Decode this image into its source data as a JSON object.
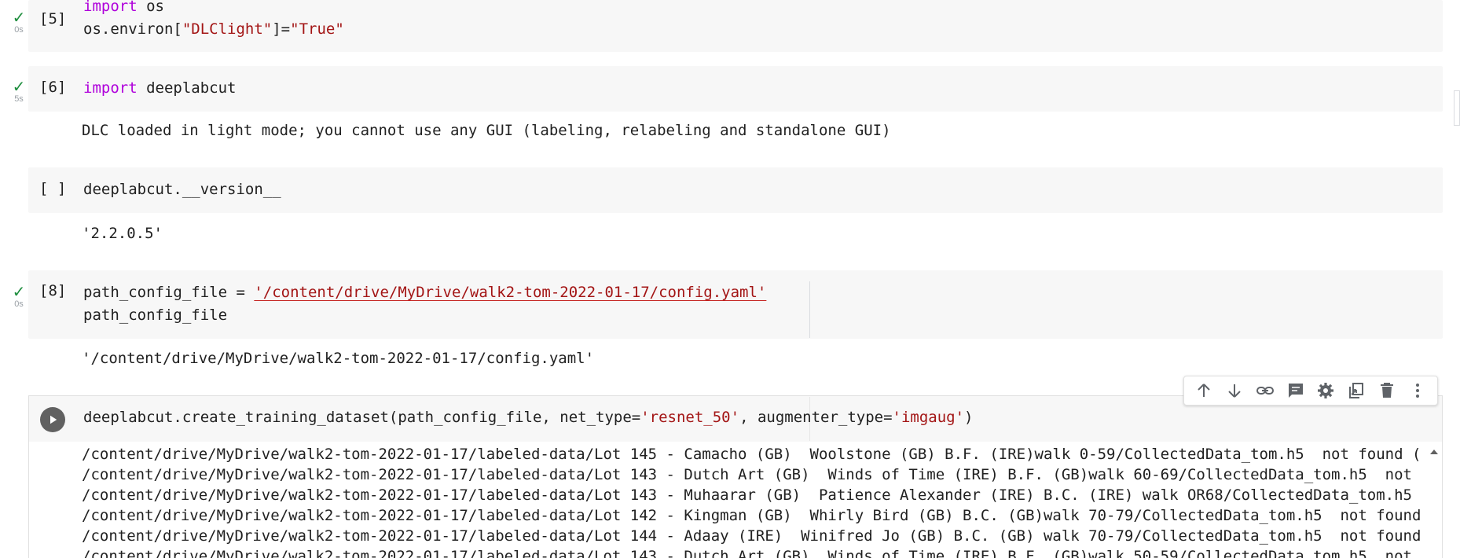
{
  "cells": [
    {
      "prompt": "[5]",
      "status": "✓",
      "duration": "0s",
      "code_lines": [
        [
          {
            "t": "import",
            "c": "kw"
          },
          {
            "t": " os",
            "c": ""
          }
        ],
        [
          {
            "t": "os.environ[",
            "c": ""
          },
          {
            "t": "\"DLClight\"",
            "c": "str"
          },
          {
            "t": "]=",
            "c": ""
          },
          {
            "t": "\"True\"",
            "c": "str"
          }
        ]
      ],
      "output": []
    },
    {
      "prompt": "[6]",
      "status": "✓",
      "duration": "5s",
      "code_lines": [
        [
          {
            "t": "import",
            "c": "kw"
          },
          {
            "t": " deeplabcut",
            "c": ""
          }
        ]
      ],
      "output": [
        "DLC loaded in light mode; you cannot use any GUI (labeling, relabeling and standalone GUI)"
      ]
    },
    {
      "prompt": "[ ]",
      "status": "",
      "duration": "",
      "code_lines": [
        [
          {
            "t": "deeplabcut.__version__",
            "c": ""
          }
        ]
      ],
      "output": [
        "'2.2.0.5'"
      ]
    },
    {
      "prompt": "[8]",
      "status": "✓",
      "duration": "0s",
      "code_lines": [
        [
          {
            "t": "path_config_file = ",
            "c": ""
          },
          {
            "t": "'/content/drive/MyDrive/walk2-tom-2022-01-17/config.yaml'",
            "c": "str-u"
          }
        ],
        [
          {
            "t": "path_config_file",
            "c": ""
          }
        ]
      ],
      "output": [
        "'/content/drive/MyDrive/walk2-tom-2022-01-17/config.yaml'"
      ]
    }
  ],
  "active_cell": {
    "code_line": [
      {
        "t": "deeplabcut.create_training_dataset(path_config_file, net_type=",
        "c": ""
      },
      {
        "t": "'resnet_50'",
        "c": "str"
      },
      {
        "t": ", augmenter_type=",
        "c": ""
      },
      {
        "t": "'imgaug'",
        "c": "str"
      },
      {
        "t": ")",
        "c": ""
      }
    ],
    "output": [
      "/content/drive/MyDrive/walk2-tom-2022-01-17/labeled-data/Lot 145 - Camacho (GB)  Woolstone (GB) B.F. (IRE)walk 0-59/CollectedData_tom.h5  not found (",
      "/content/drive/MyDrive/walk2-tom-2022-01-17/labeled-data/Lot 143 - Dutch Art (GB)  Winds of Time (IRE) B.F. (GB)walk 60-69/CollectedData_tom.h5  not",
      "/content/drive/MyDrive/walk2-tom-2022-01-17/labeled-data/Lot 143 - Muhaarar (GB)  Patience Alexander (IRE) B.C. (IRE) walk OR68/CollectedData_tom.h5",
      "/content/drive/MyDrive/walk2-tom-2022-01-17/labeled-data/Lot 142 - Kingman (GB)  Whirly Bird (GB) B.C. (GB)walk 70-79/CollectedData_tom.h5  not found",
      "/content/drive/MyDrive/walk2-tom-2022-01-17/labeled-data/Lot 144 - Adaay (IRE)  Winifred Jo (GB) B.C. (GB) walk 70-79/CollectedData_tom.h5  not found",
      "/content/drive/MyDrive/walk2-tom-2022-01-17/labeled-data/Lot 143 - Dutch Art (GB)  Winds of Time (IRE) B.F. (GB)walk 50-59/CollectedData_tom.h5  not"
    ]
  },
  "toolbar": {
    "buttons": [
      "arrow-up-icon",
      "arrow-down-icon",
      "link-icon",
      "comment-icon",
      "gear-icon",
      "mirror-cell-icon",
      "delete-icon",
      "more-vert-icon"
    ]
  },
  "colors": {
    "keyword": "#af00db",
    "string": "#a31515",
    "success": "#1e8e3e",
    "cell_bg": "#f7f7f7"
  }
}
